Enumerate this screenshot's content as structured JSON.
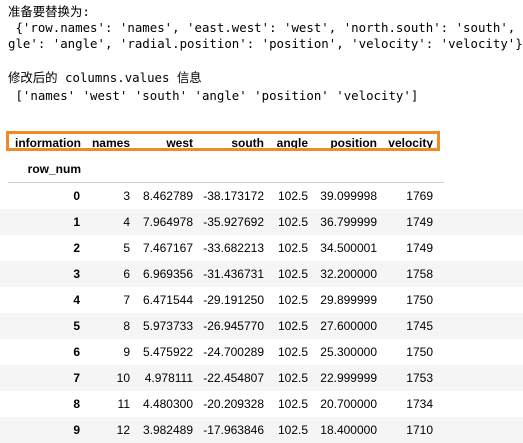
{
  "output": {
    "line1": "准备要替换为:",
    "line2": " {'row.names': 'names', 'east.west': 'west', 'north.south': 'south', 'an",
    "line3": "gle': 'angle', 'radial.position': 'position', 'velocity': 'velocity'}",
    "line4": "修改后的 columns.values 信息",
    "line5": " ['names' 'west' 'south' 'angle' 'position' 'velocity']"
  },
  "table": {
    "headers": [
      "information",
      "names",
      "west",
      "south",
      "angle",
      "position",
      "velocity"
    ],
    "index_name": "row_num",
    "rows": [
      {
        "idx": "0",
        "names": "3",
        "west": "8.462789",
        "south": "-38.173172",
        "angle": "102.5",
        "position": "39.099998",
        "velocity": "1769"
      },
      {
        "idx": "1",
        "names": "4",
        "west": "7.964978",
        "south": "-35.927692",
        "angle": "102.5",
        "position": "36.799999",
        "velocity": "1749"
      },
      {
        "idx": "2",
        "names": "5",
        "west": "7.467167",
        "south": "-33.682213",
        "angle": "102.5",
        "position": "34.500001",
        "velocity": "1749"
      },
      {
        "idx": "3",
        "names": "6",
        "west": "6.969356",
        "south": "-31.436731",
        "angle": "102.5",
        "position": "32.200000",
        "velocity": "1758"
      },
      {
        "idx": "4",
        "names": "7",
        "west": "6.471544",
        "south": "-29.191250",
        "angle": "102.5",
        "position": "29.899999",
        "velocity": "1750"
      },
      {
        "idx": "5",
        "names": "8",
        "west": "5.973733",
        "south": "-26.945770",
        "angle": "102.5",
        "position": "27.600000",
        "velocity": "1745"
      },
      {
        "idx": "6",
        "names": "9",
        "west": "5.475922",
        "south": "-24.700289",
        "angle": "102.5",
        "position": "25.300000",
        "velocity": "1750"
      },
      {
        "idx": "7",
        "names": "10",
        "west": "4.978111",
        "south": "-22.454807",
        "angle": "102.5",
        "position": "22.999999",
        "velocity": "1753"
      },
      {
        "idx": "8",
        "names": "11",
        "west": "4.480300",
        "south": "-20.209328",
        "angle": "102.5",
        "position": "20.700000",
        "velocity": "1734"
      },
      {
        "idx": "9",
        "names": "12",
        "west": "3.982489",
        "south": "-17.963846",
        "angle": "102.5",
        "position": "18.400000",
        "velocity": "1710"
      }
    ]
  },
  "colors": {
    "highlight": "#f08a24",
    "stripe": "#f5f5f5"
  }
}
